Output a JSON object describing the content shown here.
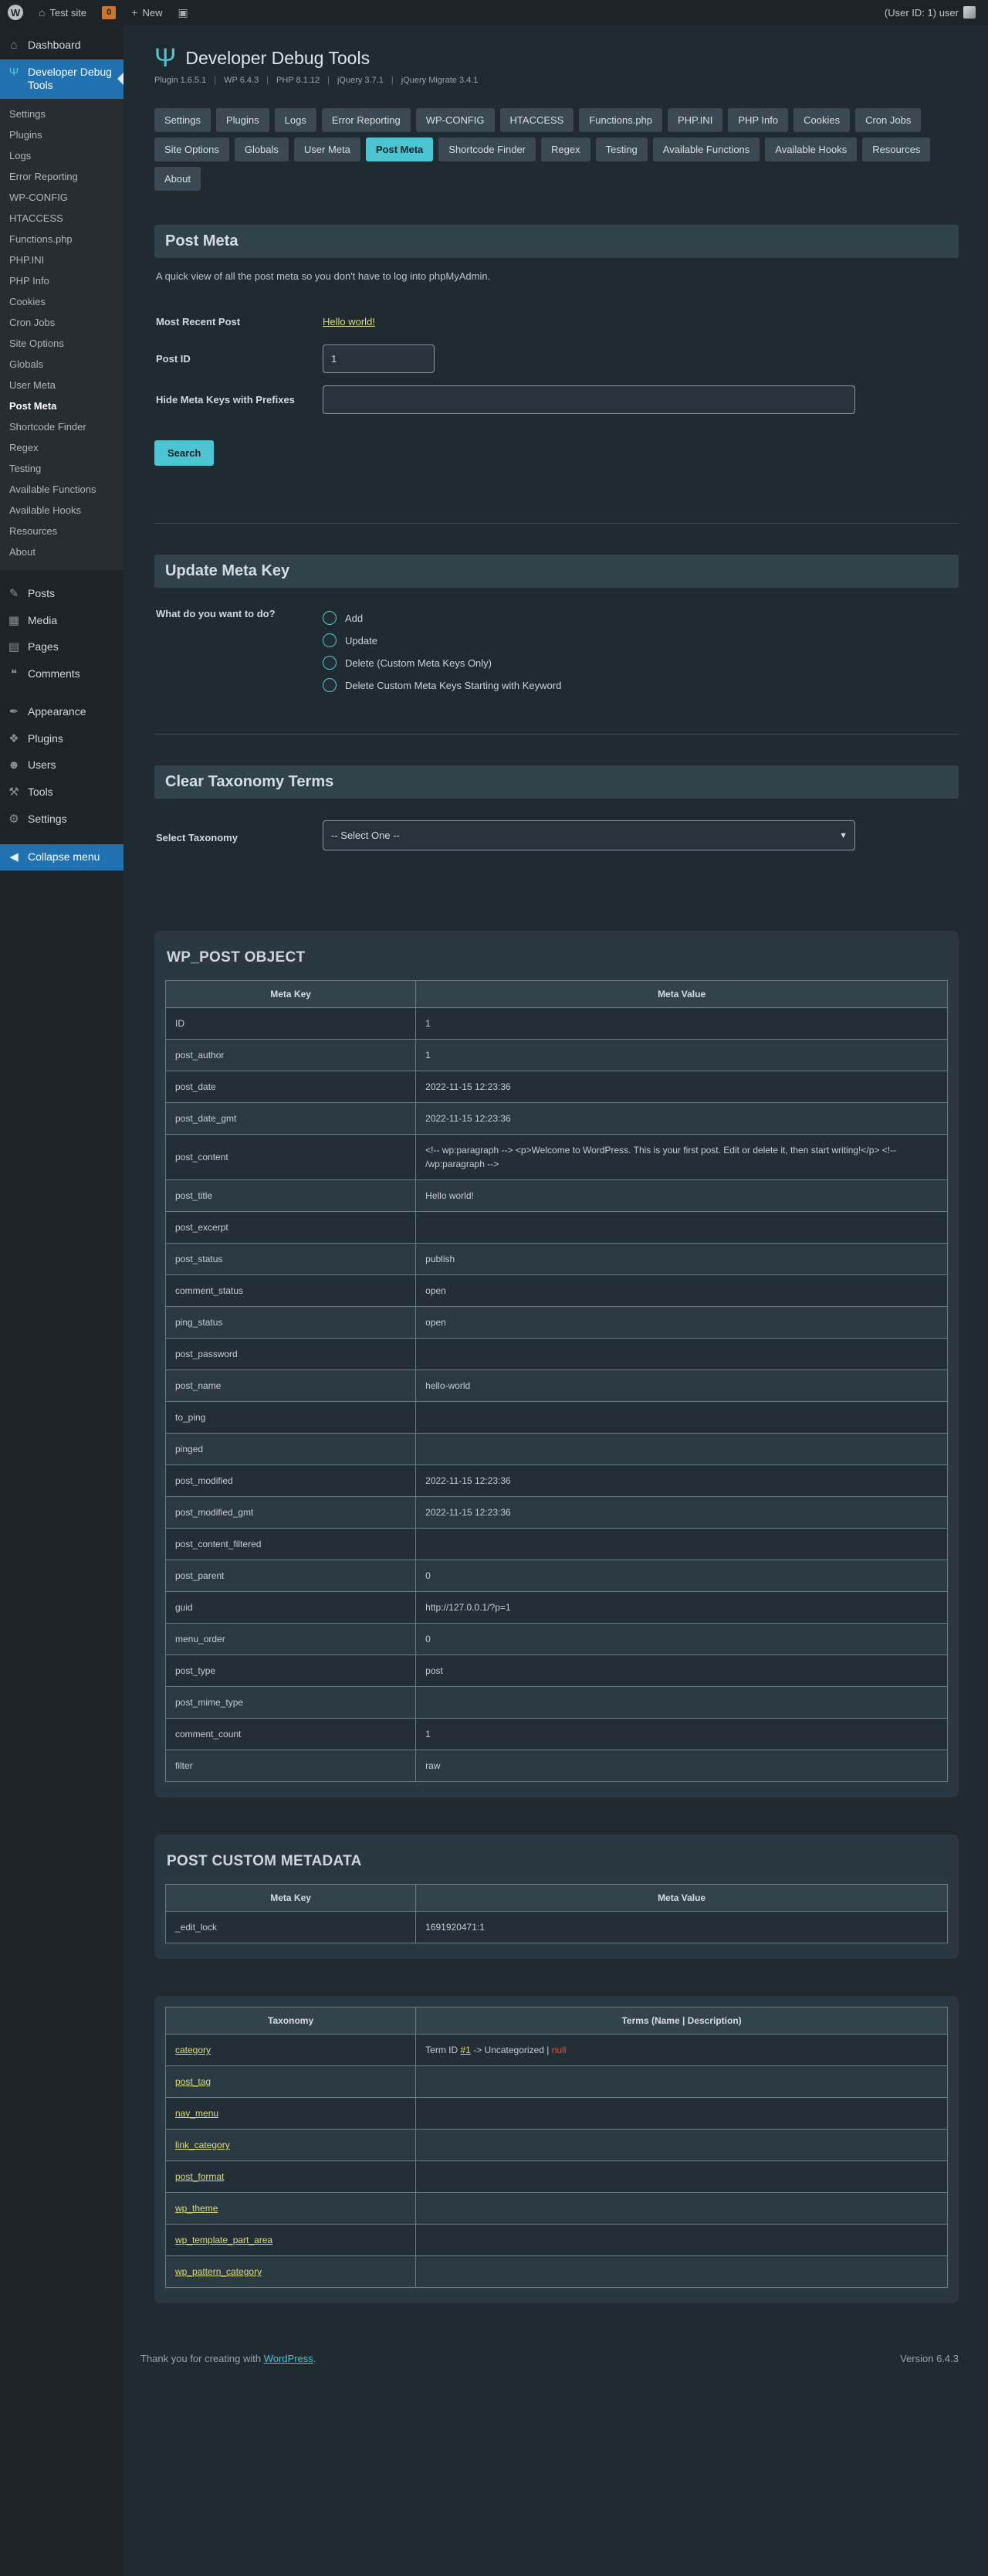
{
  "colors": {
    "accent_cyan": "#4cc4d1",
    "selected_blue": "#2271b1",
    "link_yellow": "#d9dc7f",
    "error_red": "#e2503c"
  },
  "admin_bar": {
    "site_name": "Test site",
    "comments_count": "0",
    "new_label": "New",
    "user_label": "(User ID: 1) user"
  },
  "sidebar": {
    "items": [
      {
        "label": "Dashboard",
        "icon_glyph": "⌂",
        "icon": "dashboard-icon"
      },
      {
        "label": "Developer Debug Tools",
        "icon_glyph": "Ψ",
        "icon": "trident-icon",
        "current": true,
        "has_submenu": true
      },
      {
        "separator": true
      },
      {
        "label": "Posts",
        "icon_glyph": "✎",
        "icon": "posts-icon"
      },
      {
        "label": "Media",
        "icon_glyph": "▦",
        "icon": "media-icon"
      },
      {
        "label": "Pages",
        "icon_glyph": "▤",
        "icon": "pages-icon"
      },
      {
        "label": "Comments",
        "icon_glyph": "❝",
        "icon": "comments-icon"
      },
      {
        "separator": true
      },
      {
        "label": "Appearance",
        "icon_glyph": "✒",
        "icon": "appearance-icon"
      },
      {
        "label": "Plugins",
        "icon_glyph": "❖",
        "icon": "plugins-icon"
      },
      {
        "label": "Users",
        "icon_glyph": "☻",
        "icon": "users-icon"
      },
      {
        "label": "Tools",
        "icon_glyph": "⚒",
        "icon": "tools-icon"
      },
      {
        "label": "Settings",
        "icon_glyph": "⚙",
        "icon": "settings-icon"
      },
      {
        "separator": true
      },
      {
        "label": "Collapse menu",
        "icon_glyph": "◀",
        "icon": "collapse-icon",
        "highlight": true
      }
    ],
    "submenu": [
      "Settings",
      "Plugins",
      "Logs",
      "Error Reporting",
      "WP-CONFIG",
      "HTACCESS",
      "Functions.php",
      "PHP.INI",
      "PHP Info",
      "Cookies",
      "Cron Jobs",
      "Site Options",
      "Globals",
      "User Meta",
      "Post Meta",
      "Shortcode Finder",
      "Regex",
      "Testing",
      "Available Functions",
      "Available Hooks",
      "Resources",
      "About"
    ],
    "submenu_current": "Post Meta"
  },
  "header": {
    "title": "Developer Debug Tools",
    "version_parts": [
      "Plugin 1.6.5.1",
      "WP 6.4.3",
      "PHP 8.1.12",
      "jQuery 3.7.1",
      "jQuery Migrate 3.4.1"
    ]
  },
  "tabs": {
    "active": "Post Meta",
    "items": [
      "Settings",
      "Plugins",
      "Logs",
      "Error Reporting",
      "WP-CONFIG",
      "HTACCESS",
      "Functions.php",
      "PHP.INI",
      "PHP Info",
      "Cookies",
      "Cron Jobs",
      "Site Options",
      "Globals",
      "User Meta",
      "Post Meta",
      "Shortcode Finder",
      "Regex",
      "Testing",
      "Available Functions",
      "Available Hooks",
      "Resources",
      "About"
    ]
  },
  "post_meta": {
    "heading": "Post Meta",
    "description": "A quick view of all the post meta so you don't have to log into phpMyAdmin.",
    "most_recent_label": "Most Recent Post",
    "most_recent_link": "Hello world!",
    "post_id_label": "Post ID",
    "post_id_value": "1",
    "hide_prefixes_label": "Hide Meta Keys with Prefixes",
    "hide_prefixes_value": "",
    "search_button": "Search"
  },
  "update_meta_key": {
    "heading": "Update Meta Key",
    "question_label": "What do you want to do?",
    "options": [
      "Add",
      "Update",
      "Delete (Custom Meta Keys Only)",
      "Delete Custom Meta Keys Starting with Keyword"
    ]
  },
  "clear_taxonomy": {
    "heading": "Clear Taxonomy Terms",
    "select_label": "Select Taxonomy",
    "select_placeholder": "-- Select One --"
  },
  "wp_post_table": {
    "title": "WP_POST OBJECT",
    "headers": [
      "Meta Key",
      "Meta Value"
    ],
    "rows": [
      [
        "ID",
        "1"
      ],
      [
        "post_author",
        "1"
      ],
      [
        "post_date",
        "2022-11-15 12:23:36"
      ],
      [
        "post_date_gmt",
        "2022-11-15 12:23:36"
      ],
      [
        "post_content",
        "<!-- wp:paragraph --> <p>Welcome to WordPress. This is your first post. Edit or delete it, then start writing!</p> <!-- /wp:paragraph -->"
      ],
      [
        "post_title",
        "Hello world!"
      ],
      [
        "post_excerpt",
        ""
      ],
      [
        "post_status",
        "publish"
      ],
      [
        "comment_status",
        "open"
      ],
      [
        "ping_status",
        "open"
      ],
      [
        "post_password",
        ""
      ],
      [
        "post_name",
        "hello-world"
      ],
      [
        "to_ping",
        ""
      ],
      [
        "pinged",
        ""
      ],
      [
        "post_modified",
        "2022-11-15 12:23:36"
      ],
      [
        "post_modified_gmt",
        "2022-11-15 12:23:36"
      ],
      [
        "post_content_filtered",
        ""
      ],
      [
        "post_parent",
        "0"
      ],
      [
        "guid",
        "http://127.0.0.1/?p=1"
      ],
      [
        "menu_order",
        "0"
      ],
      [
        "post_type",
        "post"
      ],
      [
        "post_mime_type",
        ""
      ],
      [
        "comment_count",
        "1"
      ],
      [
        "filter",
        "raw"
      ]
    ]
  },
  "custom_meta_table": {
    "title": "POST CUSTOM METADATA",
    "headers": [
      "Meta Key",
      "Meta Value"
    ],
    "rows": [
      [
        "_edit_lock",
        "1691920471:1"
      ]
    ]
  },
  "taxonomy_table": {
    "headers": [
      "Taxonomy",
      "Terms (Name | Description)"
    ],
    "rows": [
      {
        "taxonomy": "category",
        "term": {
          "prefix": "Term ID ",
          "link": "#1",
          "middle": " -> Uncategorized | ",
          "null_text": "null"
        }
      },
      {
        "taxonomy": "post_tag"
      },
      {
        "taxonomy": "nav_menu"
      },
      {
        "taxonomy": "link_category"
      },
      {
        "taxonomy": "post_format"
      },
      {
        "taxonomy": "wp_theme"
      },
      {
        "taxonomy": "wp_template_part_area"
      },
      {
        "taxonomy": "wp_pattern_category"
      }
    ]
  },
  "footer": {
    "thanks_prefix": "Thank you for creating with ",
    "wordpress_link": "WordPress",
    "thanks_suffix": ".",
    "version": "Version 6.4.3"
  }
}
